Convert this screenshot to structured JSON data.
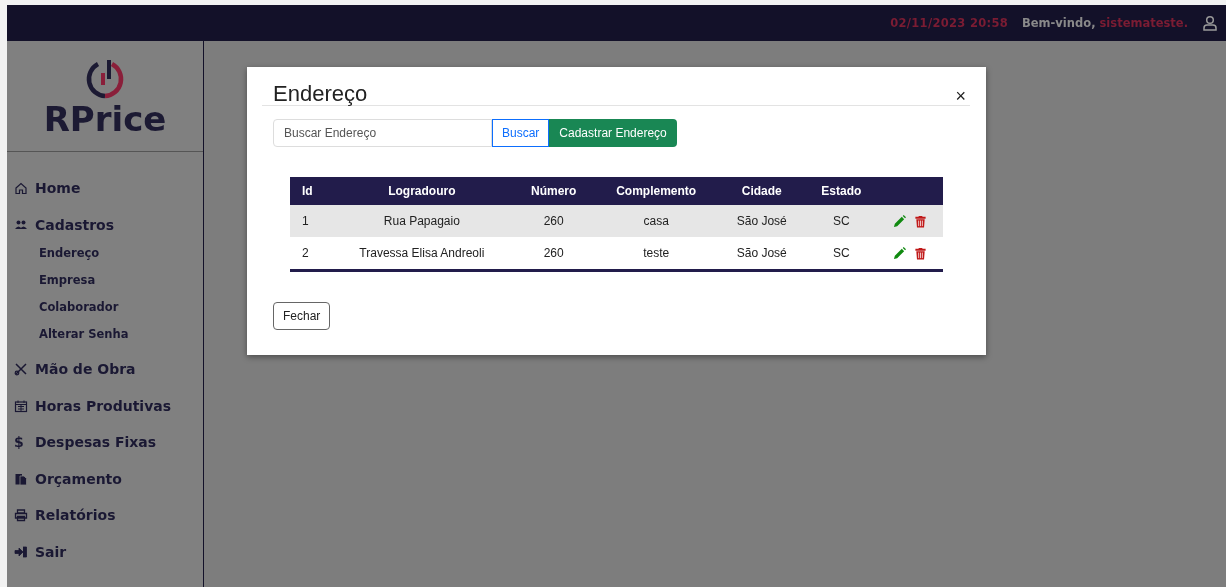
{
  "header": {
    "datetime": "02/11/2023 20:58",
    "greeting": "Bem-vindo,",
    "username": "sistemateste."
  },
  "sidebar": {
    "logo": "RPrice",
    "items": [
      {
        "label": "Home"
      },
      {
        "label": "Cadastros",
        "children": [
          {
            "label": "Endereço"
          },
          {
            "label": "Empresa"
          },
          {
            "label": "Colaborador"
          },
          {
            "label": "Alterar Senha"
          }
        ]
      },
      {
        "label": "Mão de Obra"
      },
      {
        "label": "Horas Produtivas"
      },
      {
        "label": "Despesas Fixas",
        "icon": "$"
      },
      {
        "label": "Orçamento"
      },
      {
        "label": "Relatórios"
      },
      {
        "label": "Sair"
      }
    ]
  },
  "modal": {
    "title": "Endereço",
    "close": "×",
    "search": {
      "placeholder": "Buscar Endereço"
    },
    "search_button": "Buscar",
    "add_button": "Cadastrar Endereço",
    "table": {
      "columns": [
        "Id",
        "Logradouro",
        "Número",
        "Complemento",
        "Cidade",
        "Estado"
      ],
      "rows": [
        [
          "1",
          "Rua Papagaio",
          "260",
          "casa",
          "São José",
          "SC"
        ],
        [
          "2",
          "Travessa Elisa Andreoli",
          "260",
          "teste",
          "São José",
          "SC"
        ]
      ]
    },
    "footer_button": "Fechar"
  }
}
